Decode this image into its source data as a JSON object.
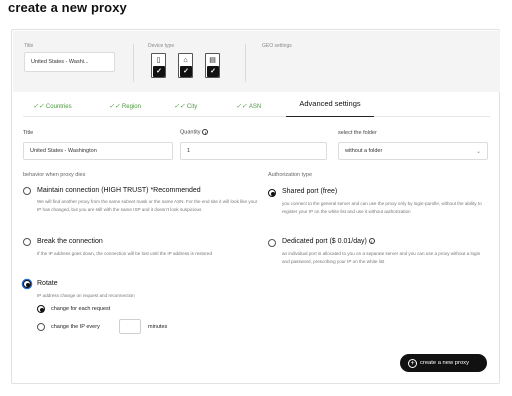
{
  "page": {
    "title": "create a new proxy"
  },
  "top_panel": {
    "title_label": "Title",
    "title_value": "United States - Washi...",
    "device_type_label": "Device type",
    "geo_settings_label": "GEO settings",
    "devices": [
      {
        "icon": "phone-icon",
        "glyph": "▯",
        "checked": true
      },
      {
        "icon": "home-icon",
        "glyph": "⌂",
        "checked": true
      },
      {
        "icon": "server-icon",
        "glyph": "▤",
        "checked": true
      }
    ]
  },
  "tabs": [
    {
      "label": "Countries",
      "done": true
    },
    {
      "label": "Region",
      "done": true
    },
    {
      "label": "City",
      "done": true
    },
    {
      "label": "ASN",
      "done": true
    },
    {
      "label": "Advanced settings",
      "active": true
    }
  ],
  "form": {
    "title_label": "Title",
    "title_value": "United States - Washington",
    "quantity_label": "Quantity",
    "quantity_value": "1",
    "folder_label": "select the folder",
    "folder_value": "without a folder"
  },
  "behavior": {
    "section_label": "behavior when proxy dies",
    "options": [
      {
        "title": "Maintain connection (HIGH TRUST) *Recommended",
        "description": "We will find another proxy from the same subnet mask or the same ASN. For the end site it will look like your IP has changed, but you are still with the same ISP and it doesn't look suspicious",
        "selected": false
      },
      {
        "title": "Break the connection",
        "description": "If the IP address goes down, the connection will be lost until the IP address is restored",
        "selected": false
      },
      {
        "title": "Rotate",
        "description": "IP address change on request and reconnection",
        "selected": true
      }
    ],
    "rotate_options": [
      {
        "label": "change for each request",
        "selected": true
      },
      {
        "label": "change the IP every",
        "selected": false,
        "suffix": "minutes"
      }
    ]
  },
  "authorization": {
    "section_label": "Authorization type",
    "options": [
      {
        "title": "Shared port (free)",
        "description": "you connect to the general server and can use the proxy only by login-parolle, without the ability to register your IP on the white list and use it without authorization",
        "selected": true
      },
      {
        "title": "Dedicated port ($ 0.01/day)",
        "description": "an individual port is allocated to you on a separate server and you can use a proxy without a login and password, prescribing your IP on the white list",
        "selected": false
      }
    ]
  },
  "actions": {
    "create_label": "create a new proxy"
  }
}
